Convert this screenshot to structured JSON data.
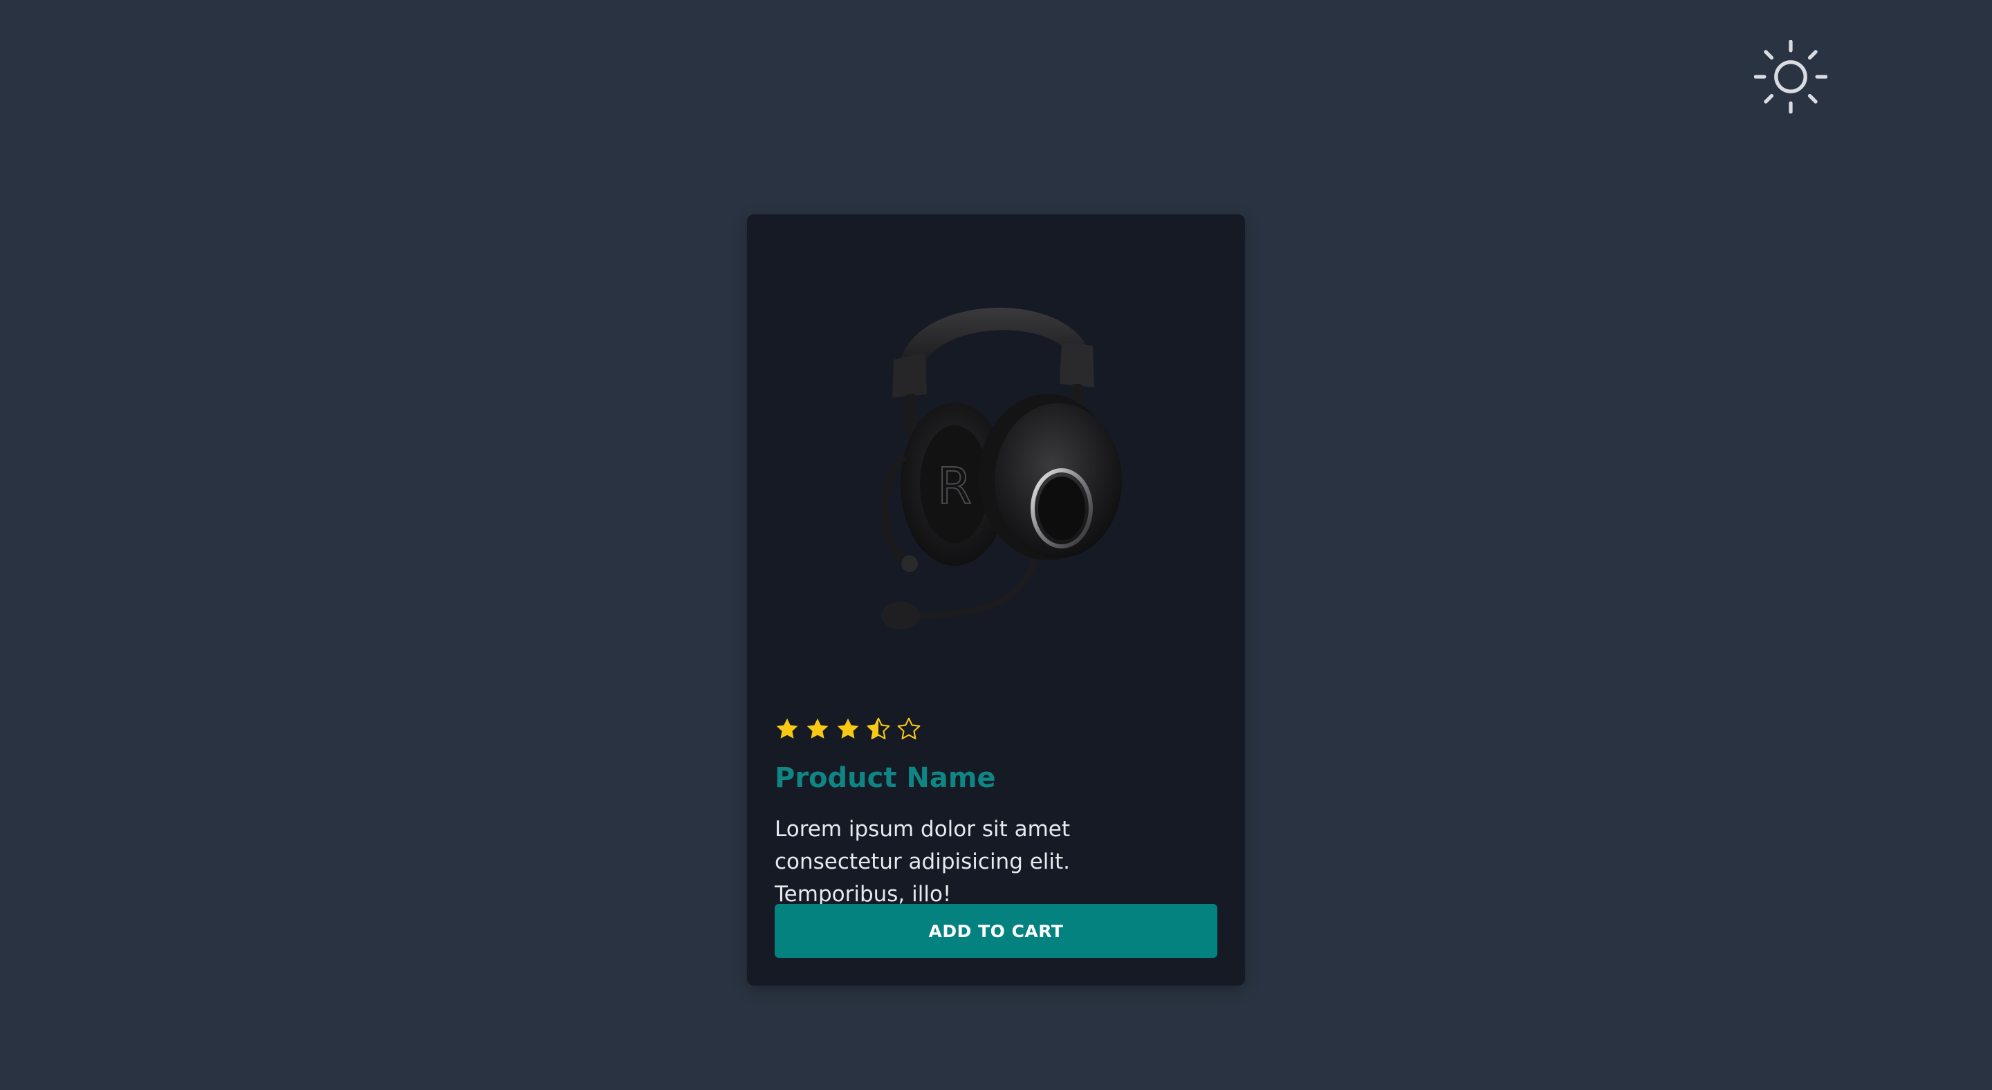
{
  "header": {
    "theme_toggle_icon": "sun-icon"
  },
  "product_card": {
    "image_icon": "headset-image",
    "rating": {
      "value": 3.5,
      "max": 5,
      "filled_color": "#f8c914"
    },
    "name": "Product Name",
    "description": "Lorem ipsum dolor sit amet consectetur adipisicing elit. Temporibus, illo!",
    "cta_label": "ADD TO CART"
  },
  "colors": {
    "page_background": "#2a3341",
    "card_background": "#151a24",
    "accent": "#038280",
    "title": "#0f8584",
    "text": "#e7e9ee"
  }
}
